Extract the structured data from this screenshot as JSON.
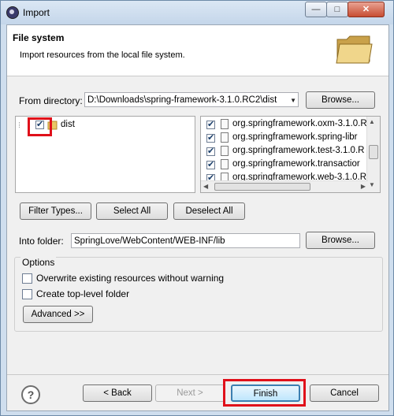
{
  "window": {
    "title": "Import",
    "minimize": "—",
    "maximize": "□",
    "close": "✕"
  },
  "banner": {
    "title": "File system",
    "description": "Import resources from the local file system."
  },
  "from_directory": {
    "label": "From directory:",
    "value": "D:\\Downloads\\spring-framework-3.1.0.RC2\\dist",
    "browse": "Browse..."
  },
  "tree": {
    "items": [
      {
        "label": "dist",
        "checked": true
      }
    ]
  },
  "files": [
    {
      "name": "org.springframework.oxm-3.1.0.R",
      "checked": true
    },
    {
      "name": "org.springframework.spring-libr",
      "checked": true
    },
    {
      "name": "org.springframework.test-3.1.0.R",
      "checked": true
    },
    {
      "name": "org.springframework.transactior",
      "checked": true
    },
    {
      "name": "org.springframework.web-3.1.0.R",
      "checked": true
    }
  ],
  "buttons": {
    "filter_types": "Filter Types...",
    "select_all": "Select All",
    "deselect_all": "Deselect All"
  },
  "into_folder": {
    "label": "Into folder:",
    "value": "SpringLove/WebContent/WEB-INF/lib",
    "browse": "Browse..."
  },
  "options": {
    "title": "Options",
    "overwrite": "Overwrite existing resources without warning",
    "create_top": "Create top-level folder",
    "advanced": "Advanced >>"
  },
  "footer": {
    "help": "?",
    "back": "< Back",
    "next": "Next >",
    "finish": "Finish",
    "cancel": "Cancel"
  }
}
